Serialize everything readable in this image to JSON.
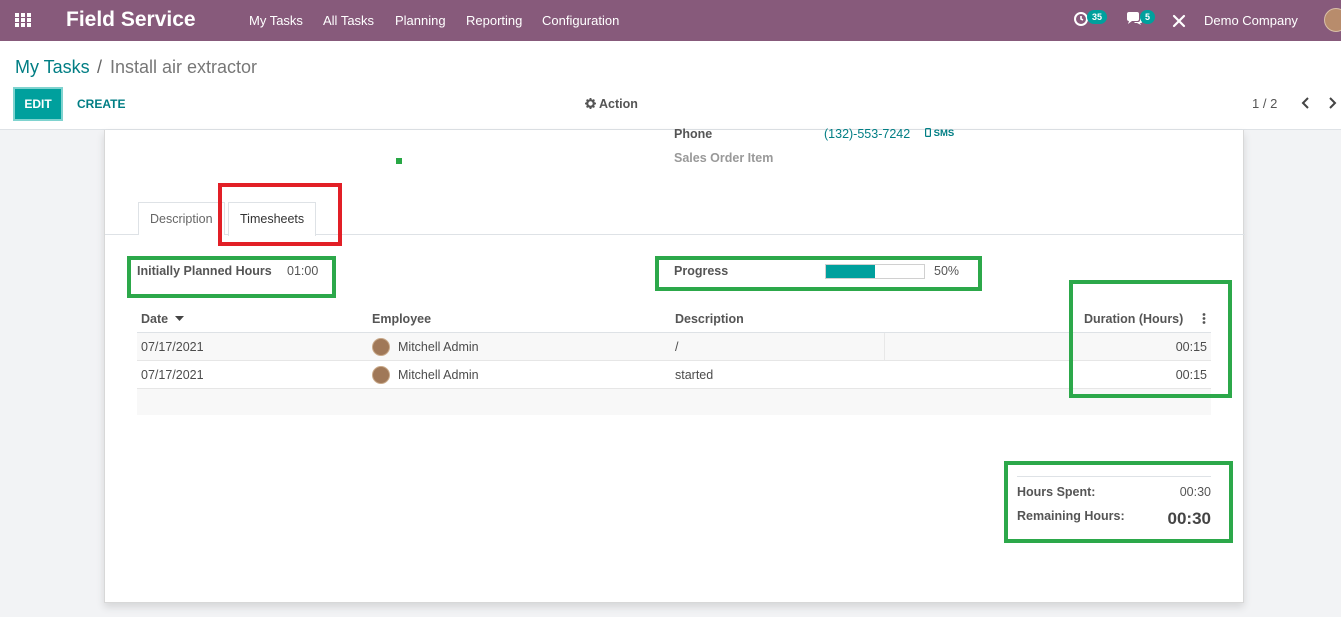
{
  "navbar": {
    "app_name": "Field Service",
    "menu": [
      "My Tasks",
      "All Tasks",
      "Planning",
      "Reporting",
      "Configuration"
    ],
    "activity_count": "35",
    "message_count": "5",
    "company": "Demo Company"
  },
  "breadcrumb": {
    "parent": "My Tasks",
    "separator": "/",
    "current": "Install air extractor"
  },
  "toolbar": {
    "edit_label": "EDIT",
    "create_label": "CREATE",
    "action_label": "Action",
    "pager": "1 / 2"
  },
  "form": {
    "phone_label": "Phone",
    "phone_value": "(132)-553-7242",
    "sms_label": "SMS",
    "sales_order_item_label": "Sales Order Item"
  },
  "tabs": {
    "description": "Description",
    "timesheets": "Timesheets",
    "active": "timesheets"
  },
  "timesheets": {
    "planned_hours_label": "Initially Planned Hours",
    "planned_hours_value": "01:00",
    "progress_label": "Progress",
    "progress_percent": 50,
    "progress_text": "50%",
    "columns": {
      "date": "Date",
      "employee": "Employee",
      "description": "Description",
      "duration": "Duration (Hours)"
    },
    "rows": [
      {
        "date": "07/17/2021",
        "employee": "Mitchell Admin",
        "description": "/",
        "duration": "00:15"
      },
      {
        "date": "07/17/2021",
        "employee": "Mitchell Admin",
        "description": "started",
        "duration": "00:15"
      }
    ],
    "hours_spent_label": "Hours Spent:",
    "hours_spent_value": "00:30",
    "remaining_hours_label": "Remaining Hours:",
    "remaining_hours_value": "00:30"
  },
  "colors": {
    "navbar": "#875a7b",
    "accent": "#00a09d",
    "link": "#017e84",
    "highlight_red": "#e21f26",
    "highlight_green": "#2ca84a"
  }
}
